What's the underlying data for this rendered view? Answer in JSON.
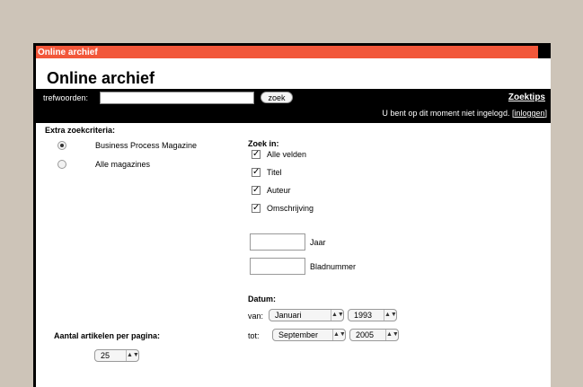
{
  "window": {
    "title": "Online archief"
  },
  "page": {
    "title": "Online archief"
  },
  "search": {
    "label": "trefwoorden:",
    "value": "",
    "button_label": "zoek",
    "tips_link": "Zoektips",
    "status_text": "U bent op dit moment niet ingelogd. [",
    "login_link": "inloggen",
    "status_close": "]"
  },
  "extra": {
    "title": "Extra zoekcriteria:",
    "magazines": [
      {
        "label": "Business Process Magazine",
        "checked": true
      },
      {
        "label": "Alle magazines",
        "checked": false
      }
    ]
  },
  "zoek_in": {
    "title": "Zoek in:",
    "options": [
      {
        "label": "Alle velden",
        "checked": true
      },
      {
        "label": "Titel",
        "checked": true
      },
      {
        "label": "Auteur",
        "checked": true
      },
      {
        "label": "Omschrijving",
        "checked": true
      }
    ]
  },
  "fields": {
    "jaar": {
      "label": "Jaar",
      "value": ""
    },
    "bladnummer": {
      "label": "Bladnummer",
      "value": ""
    }
  },
  "datum": {
    "title": "Datum:",
    "van_label": "van:",
    "van_month": "Januari",
    "van_year": "1993",
    "tot_label": "tot:",
    "tot_month": "September",
    "tot_year": "2005"
  },
  "per_page": {
    "title": "Aantal artikelen per pagina:",
    "value": "25"
  },
  "icons": {
    "select_arrow": "updown-arrow-icon",
    "check": "checkmark-icon"
  },
  "colors": {
    "titlebar": "#f2573a",
    "background": "#cdc4b8",
    "bar": "#000000"
  }
}
